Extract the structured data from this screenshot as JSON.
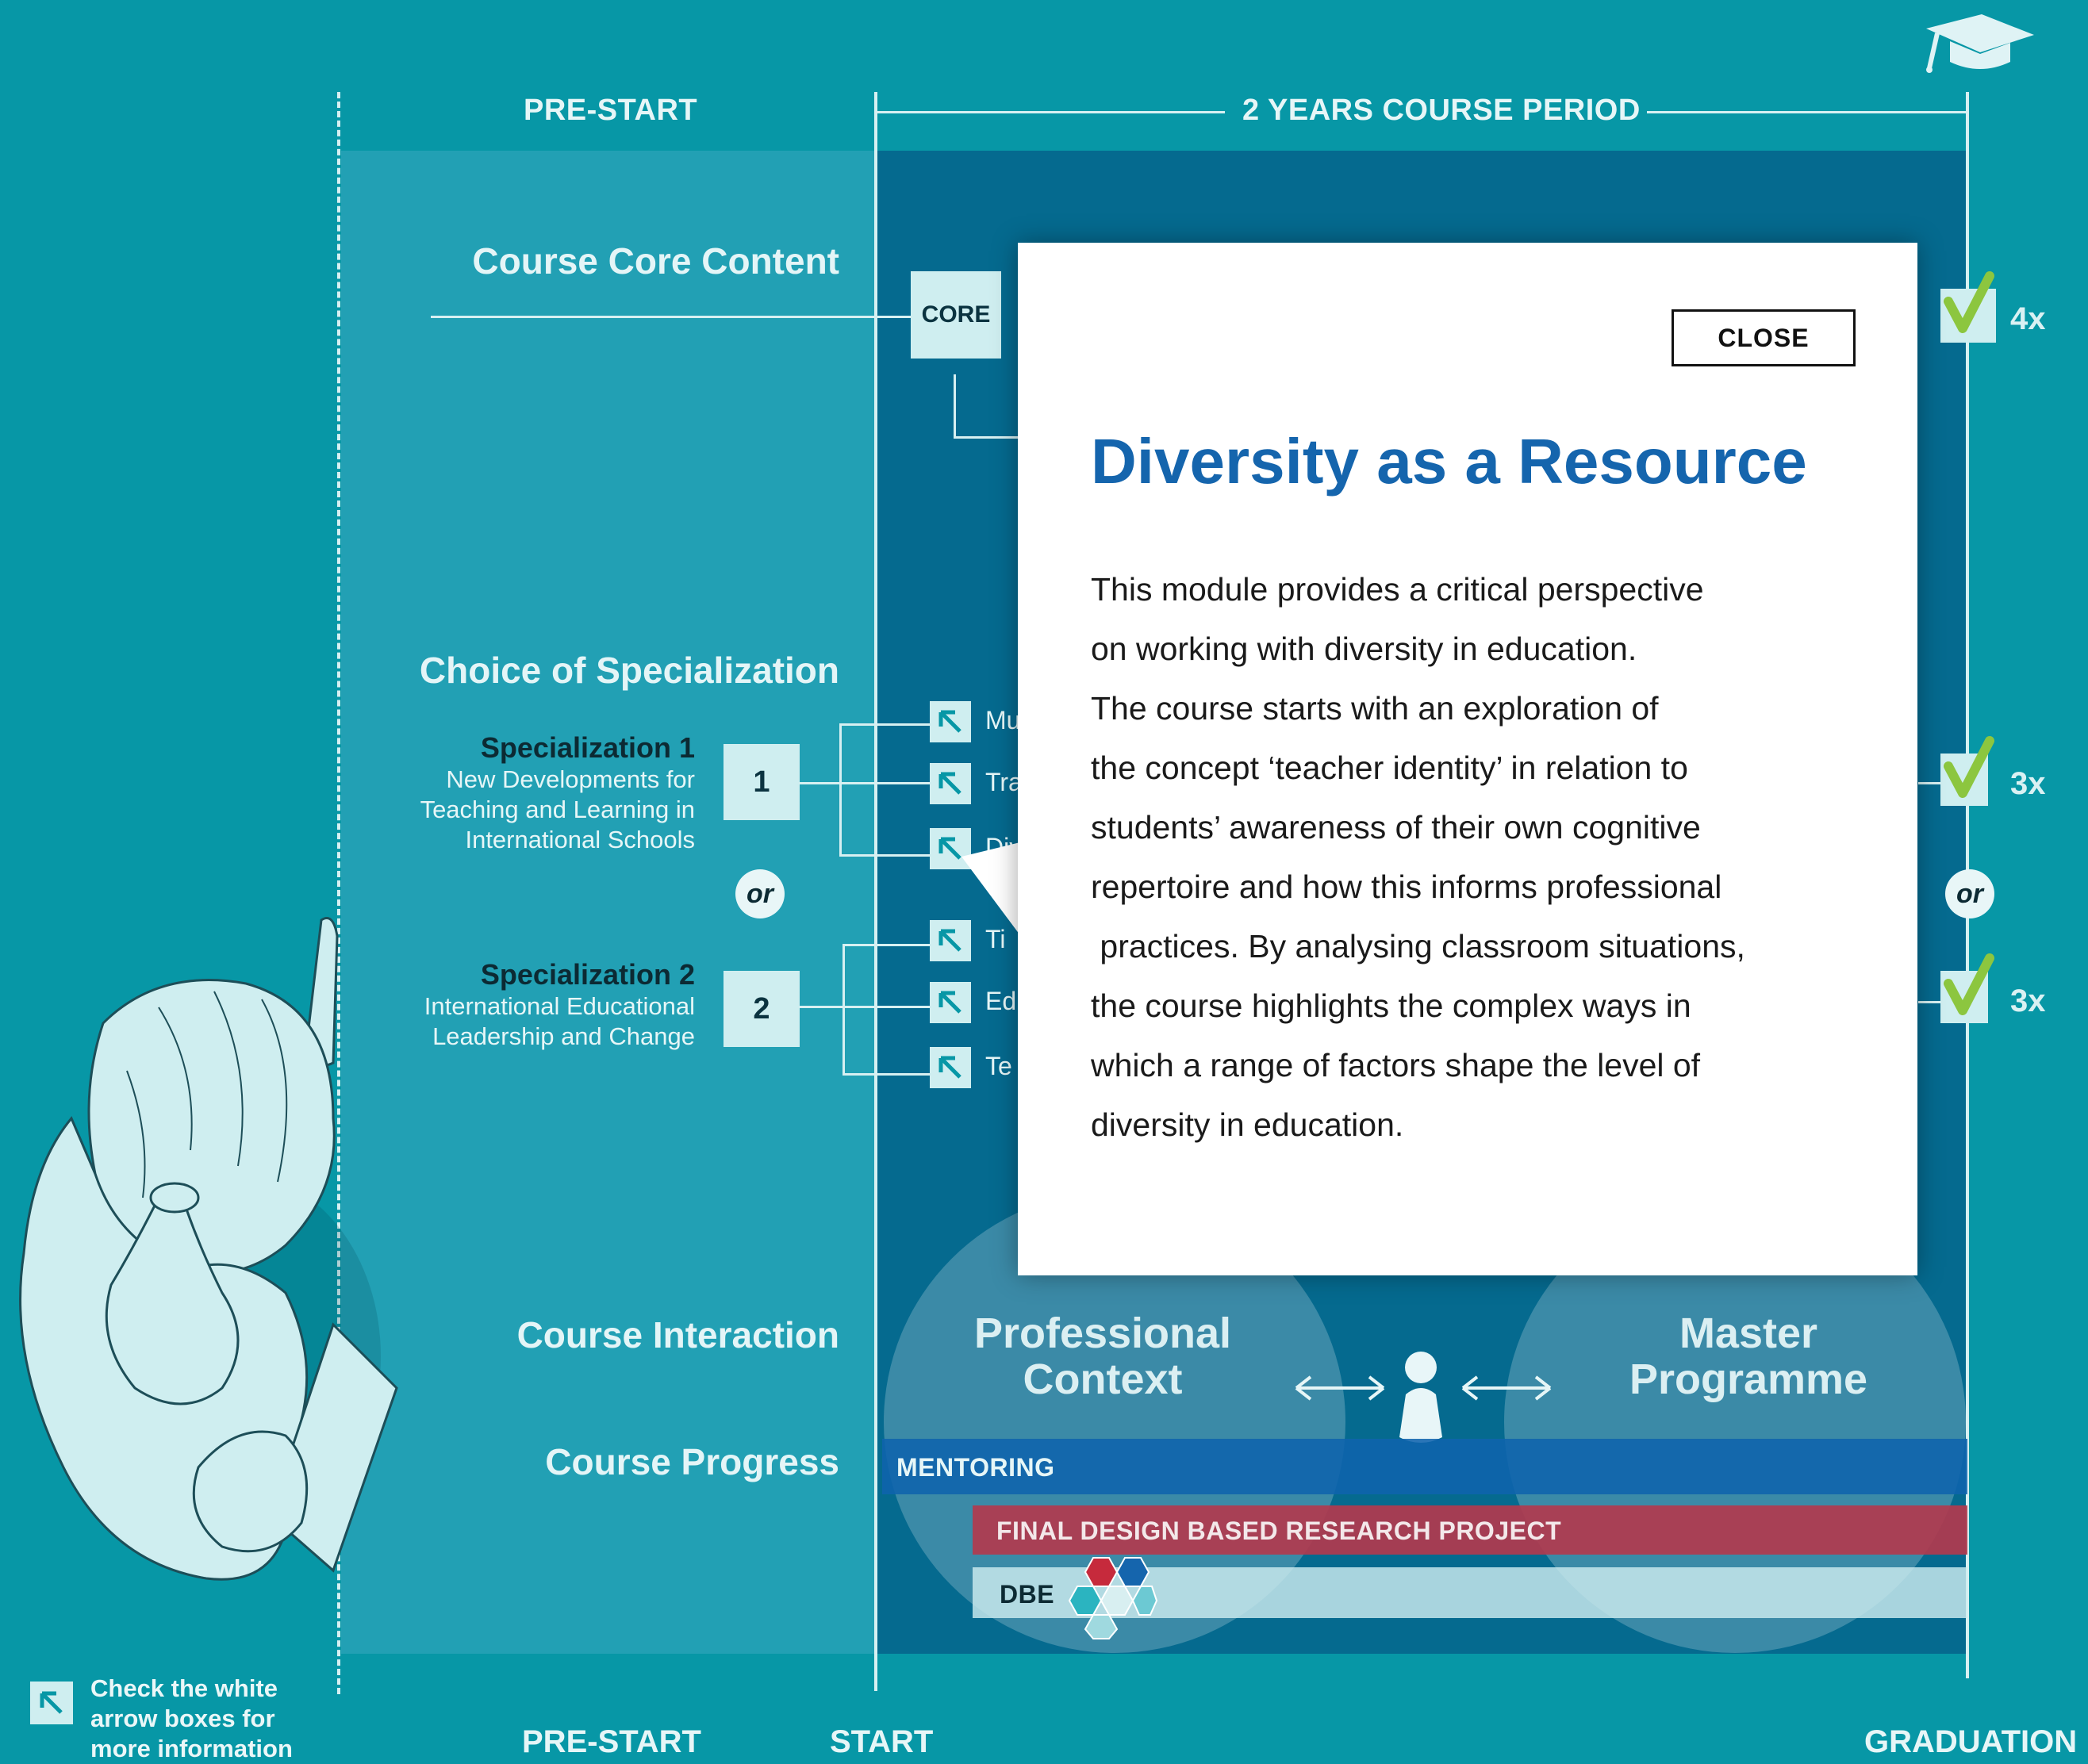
{
  "header": {
    "prestart": "PRE-START",
    "course_period": "2 YEARS COURSE PERIOD"
  },
  "rows": {
    "core_content": "Course Core Content",
    "specialization": "Choice of Specialization",
    "interaction": "Course Interaction",
    "progress": "Course Progress"
  },
  "core": {
    "label": "CORE",
    "count": "4x"
  },
  "specializations": [
    {
      "title": "Specialization 1",
      "lines": [
        "New Developments for",
        "Teaching and Learning in",
        "International Schools"
      ],
      "number": "1",
      "modules": [
        "Mu",
        "Tra",
        "Div"
      ],
      "count": "3x"
    },
    {
      "title": "Specialization 2",
      "lines": [
        "International Educational",
        "Leadership and Change"
      ],
      "number": "2",
      "modules": [
        "Ti",
        "Ed",
        "Te"
      ],
      "count": "3x"
    }
  ],
  "or_label": "or",
  "interaction": {
    "left": [
      "Professional",
      "Context"
    ],
    "right": [
      "Master",
      "Programme"
    ]
  },
  "progress_bars": {
    "mentoring": "MENTORING",
    "project": "FINAL DESIGN BASED RESEARCH PROJECT",
    "dbe": "DBE"
  },
  "legend": {
    "lines": [
      "Check the white",
      "arrow boxes for",
      "more information"
    ]
  },
  "bottom": {
    "prestart": "PRE-START",
    "start": "START",
    "graduation": "GRADUATION"
  },
  "modal": {
    "close": "CLOSE",
    "title": "Diversity as a Resource",
    "lines": [
      "This module provides a critical perspective",
      "on working with diversity in education.",
      "The course starts with an exploration of",
      "the concept ‘teacher identity’ in relation to",
      "students’ awareness of their own cognitive",
      "repertoire and how this informs professional",
      " practices. By analysing classroom situations,",
      "the course highlights the complex ways in",
      "which a range of factors shape the level of",
      "diversity in education."
    ]
  },
  "colors": {
    "background": "#0797a6",
    "course_panel": "#056a8f",
    "mentoring": "#0f63ad",
    "project": "#b23a4e",
    "title_blue": "#1565ad",
    "check_green": "#8cc63f"
  },
  "icons": [
    "graduation-cap-icon",
    "arrow-up-left-icon",
    "check-icon",
    "person-pawn-icon",
    "double-arrow-icon",
    "dbe-hexagon-logo-icon"
  ]
}
